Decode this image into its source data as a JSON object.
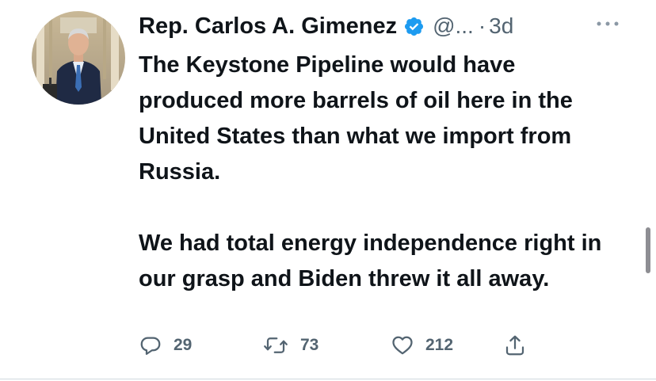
{
  "tweet": {
    "display_name": "Rep. Carlos A. Gimenez",
    "handle": "@...",
    "separator": "·",
    "time": "3d",
    "text_paragraphs": [
      "The Keystone Pipeline would have produced more barrels of oil here in the United States than what we import from Russia.",
      "We had total energy independence right in our grasp and Biden threw it all away."
    ]
  },
  "actions": {
    "reply_count": "29",
    "retweet_count": "73",
    "like_count": "212"
  },
  "icons": {
    "verified": "verified-badge-icon",
    "more": "more-options-icon",
    "reply": "reply-icon",
    "retweet": "retweet-icon",
    "like": "heart-icon",
    "share": "share-icon"
  },
  "colors": {
    "text_primary": "#0f1419",
    "text_secondary": "#536471",
    "verified_blue": "#1d9bf0"
  }
}
